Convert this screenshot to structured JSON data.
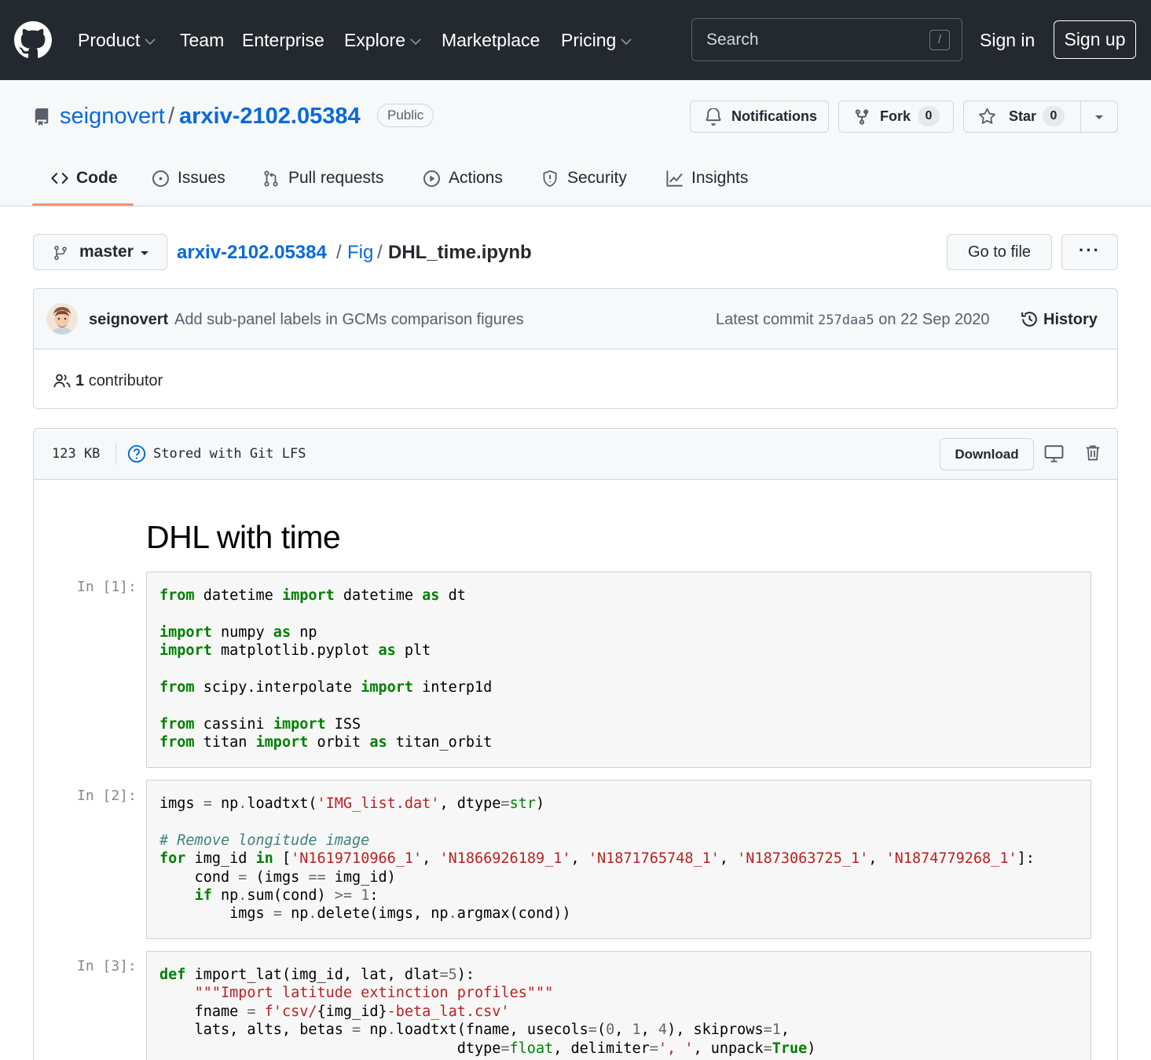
{
  "header": {
    "nav": [
      "Product",
      "Team",
      "Enterprise",
      "Explore",
      "Marketplace",
      "Pricing"
    ],
    "search_placeholder": "Search",
    "search_shortcut": "/",
    "sign_in": "Sign in",
    "sign_up": "Sign up"
  },
  "repo": {
    "owner": "seignovert",
    "separator": "/",
    "name": "arxiv-2102.05384",
    "visibility": "Public",
    "notifications_label": "Notifications",
    "fork_label": "Fork",
    "fork_count": "0",
    "star_label": "Star",
    "star_count": "0"
  },
  "tabs": [
    "Code",
    "Issues",
    "Pull requests",
    "Actions",
    "Security",
    "Insights"
  ],
  "file_nav": {
    "branch": "master",
    "breadcrumb_repo": "arxiv-2102.05384",
    "breadcrumb_sep": "/",
    "breadcrumb_folder": "Fig",
    "breadcrumb_file": "DHL_time.ipynb",
    "go_to_file": "Go to file",
    "more": "···"
  },
  "commit": {
    "author": "seignovert",
    "message": "Add sub-panel labels in GCMs comparison figures",
    "latest_label": "Latest commit",
    "sha": "257daa5",
    "date": "on 22 Sep 2020",
    "history": "History",
    "contributors_count": "1",
    "contributors_label": "contributor"
  },
  "file": {
    "size": "123 KB",
    "storage": "Stored with Git LFS",
    "download": "Download"
  },
  "notebook": {
    "title": "DHL with time",
    "prompts": [
      "In [1]:",
      "In [2]:",
      "In [3]:"
    ]
  }
}
